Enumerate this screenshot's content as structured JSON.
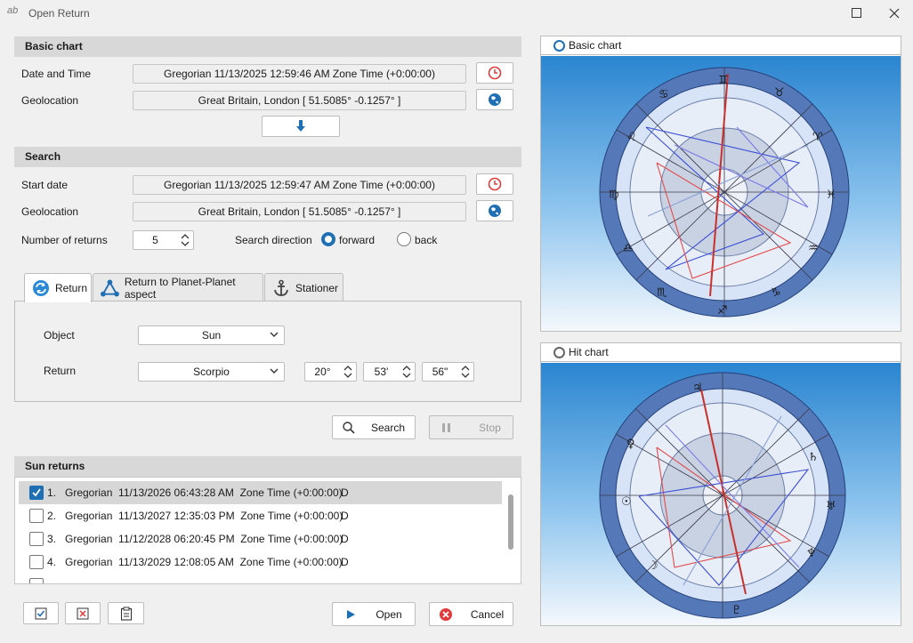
{
  "window": {
    "title": "Open Return",
    "app_icon": "ab"
  },
  "basic_chart": {
    "header": "Basic chart",
    "date_label": "Date and Time",
    "date_value": "Gregorian  11/13/2025 12:59:46 AM  Zone Time (+0:00:00)",
    "geo_label": "Geolocation",
    "geo_value": "Great Britain, London  [ 51.5085°  -0.1257° ]"
  },
  "search": {
    "header": "Search",
    "start_label": "Start date",
    "start_value": "Gregorian  11/13/2025 12:59:47 AM  Zone Time (+0:00:00)",
    "geo_label": "Geolocation",
    "geo_value": "Great Britain, London  [ 51.5085°  -0.1257° ]",
    "returns_label": "Number of returns",
    "returns_value": "5",
    "direction_label": "Search direction",
    "forward_label": "forward",
    "back_label": "back",
    "direction_selected": "forward"
  },
  "tabs": [
    {
      "label": "Return",
      "icon": "refresh-icon",
      "active": true
    },
    {
      "label": "Return to Planet-Planet aspect",
      "icon": "aspect-triangle-icon",
      "active": false
    },
    {
      "label": "Stationer",
      "icon": "anchor-icon",
      "active": false
    }
  ],
  "return_tab": {
    "object_label": "Object",
    "object_value": "Sun",
    "return_label": "Return",
    "sign_value": "Scorpio",
    "degrees": "20°",
    "minutes": "53'",
    "seconds": "56\""
  },
  "actions": {
    "search_label": "Search",
    "stop_label": "Stop"
  },
  "results": {
    "header": "Sun returns",
    "rows": [
      {
        "num": "1.",
        "text": "Gregorian  11/13/2026 06:43:28 AM  Zone Time (+0:00:00)",
        "flag": "D",
        "checked": true
      },
      {
        "num": "2.",
        "text": "Gregorian  11/13/2027 12:35:03 PM  Zone Time (+0:00:00)",
        "flag": "D",
        "checked": false
      },
      {
        "num": "3.",
        "text": "Gregorian  11/12/2028 06:20:45 PM  Zone Time (+0:00:00)",
        "flag": "D",
        "checked": false
      },
      {
        "num": "4.",
        "text": "Gregorian  11/13/2029 12:08:05 AM  Zone Time (+0:00:00)",
        "flag": "D",
        "checked": false
      }
    ]
  },
  "footer": {
    "open_label": "Open",
    "cancel_label": "Cancel"
  },
  "charts": {
    "basic_title": "Basic chart",
    "hit_title": "Hit chart"
  },
  "colors": {
    "accent": "#1f6fb4",
    "danger": "#e03a3a"
  }
}
